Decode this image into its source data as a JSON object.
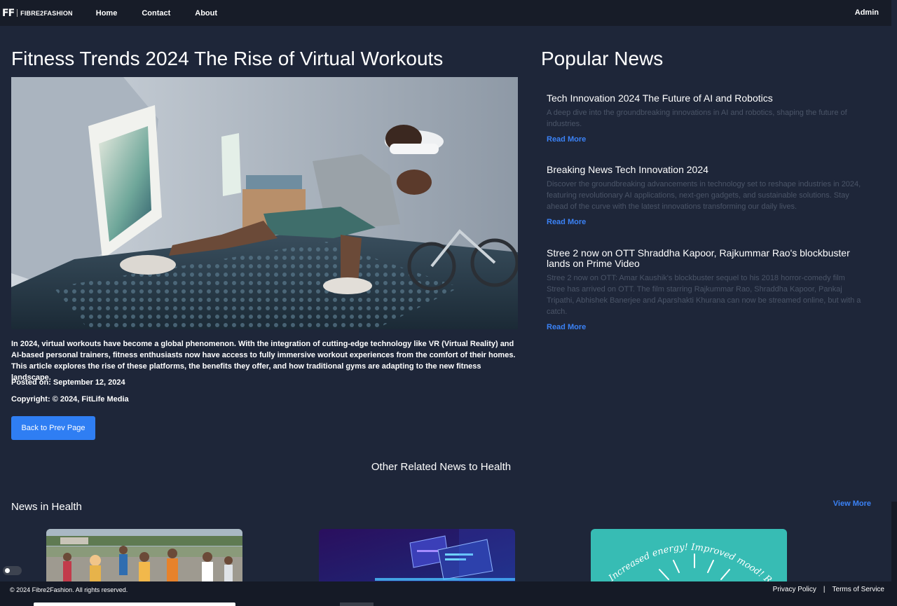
{
  "nav": {
    "logo_mark": "FF",
    "logo_text": "FIBRE2FASHION",
    "links": [
      "Home",
      "Contact",
      "About"
    ],
    "admin": "Admin"
  },
  "article": {
    "title": "Fitness Trends 2024 The Rise of Virtual Workouts",
    "body": "In 2024, virtual workouts have become a global phenomenon. With the integration of cutting-edge technology like VR (Virtual Reality) and AI-based personal trainers, fitness enthusiasts now have access to fully immersive workout experiences from the comfort of their homes. This article explores the rise of these platforms, the benefits they offer, and how traditional gyms are adapting to the new fitness landscape.",
    "posted_label": "Posted on:",
    "posted_value": "September 12, 2024",
    "copyright_label": "Copyright:",
    "copyright_value": "© 2024, FitLife Media",
    "back_button": "Back to Prev Page"
  },
  "popular": {
    "title": "Popular News",
    "items": [
      {
        "title": "Tech Innovation 2024 The Future of AI and Robotics",
        "desc": "A deep dive into the groundbreaking innovations in AI and robotics, shaping the future of industries.",
        "read_more": "Read More"
      },
      {
        "title": "Breaking News Tech Innovation 2024",
        "desc": "Discover the groundbreaking advancements in technology set to reshape industries in 2024, featuring revolutionary AI applications, next-gen gadgets, and sustainable solutions. Stay ahead of the curve with the latest innovations transforming our daily lives.",
        "read_more": "Read More"
      },
      {
        "title": "Stree 2 now on OTT Shraddha Kapoor, Rajkummar Rao's blockbuster lands on Prime Video",
        "desc": "Stree 2 now on OTT: Amar Kaushik's blockbuster sequel to his 2018 horror-comedy film Stree has arrived on OTT. The film starring Rajkummar Rao, Shraddha Kapoor, Pankaj Tripathi, Abhishek Banerjee and Aparshakti Khurana can now be streamed online, but with a catch.",
        "read_more": "Read More"
      }
    ]
  },
  "related": {
    "heading": "Other Related News to Health",
    "section_title": "News in Health",
    "view_more": "View More",
    "card3_text": "Increased energy! Improved mood! Reduced stre"
  },
  "footer": {
    "copyright": "© 2024 Fibre2Fashion. All rights reserved.",
    "privacy": "Privacy Policy",
    "separator": "|",
    "terms": "Terms of Service"
  },
  "colors": {
    "background": "#1e2639",
    "navbar": "#171c28",
    "accent": "#2f7ef3",
    "link": "#3b82f6",
    "muted_text": "#4b5568",
    "footer": "#151a26"
  }
}
